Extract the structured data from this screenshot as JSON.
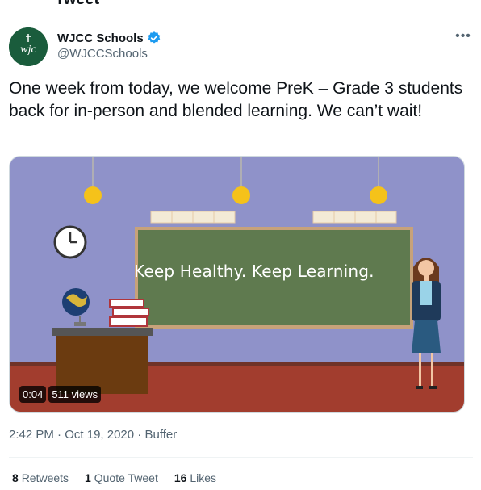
{
  "header": {
    "title": "Tweet"
  },
  "author": {
    "name": "WJCC Schools",
    "handle": "@WJCCSchools",
    "avatar_text": "wjc",
    "verified": true
  },
  "tweet": {
    "text": "One week from today, we welcome PreK – Grade 3 students back for in-person and blended learning. We can’t wait!"
  },
  "media": {
    "board_text": "Keep Healthy. Keep Learning.",
    "duration": "0:04",
    "views": "511 views"
  },
  "meta": {
    "time": "2:42 PM",
    "date": "Oct 19, 2020",
    "source": "Buffer",
    "separator": " · "
  },
  "stats": {
    "retweets": {
      "count": "8",
      "label": "Retweets"
    },
    "quotes": {
      "count": "1",
      "label": "Quote Tweet"
    },
    "likes": {
      "count": "16",
      "label": "Likes"
    }
  },
  "icons": {
    "verified": "verified-badge-icon",
    "more": "more-options-icon",
    "clock": "clock-icon",
    "globe": "globe-icon"
  },
  "colors": {
    "accent": "#1d9bf0",
    "wall": "#8f92c9",
    "floor": "#a23d2e",
    "board": "#5f7a4f"
  }
}
